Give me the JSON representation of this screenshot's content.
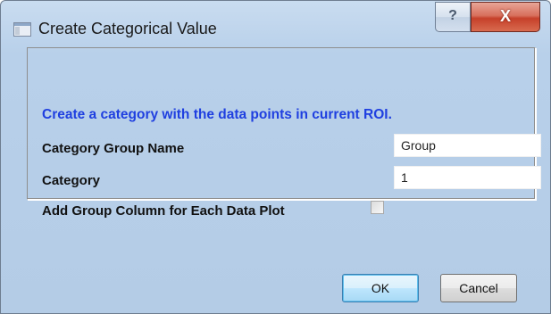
{
  "window": {
    "title": "Create Categorical Value",
    "help_glyph": "?",
    "close_glyph": "X"
  },
  "dialog": {
    "instruction": "Create a category with the data points in current ROI.",
    "fields": {
      "group_name_label": "Category Group Name",
      "group_name_value": "Group",
      "category_label": "Category",
      "category_value": "1",
      "add_column_label": "Add Group Column for Each Data Plot",
      "add_column_checked": false
    }
  },
  "buttons": {
    "ok_label": "OK",
    "cancel_label": "Cancel"
  },
  "colors": {
    "instruction_text": "#1f3fe0",
    "close_button": "#c6402a"
  },
  "icons": {
    "app": "window-app-icon",
    "help": "help-icon",
    "close": "close-icon"
  }
}
